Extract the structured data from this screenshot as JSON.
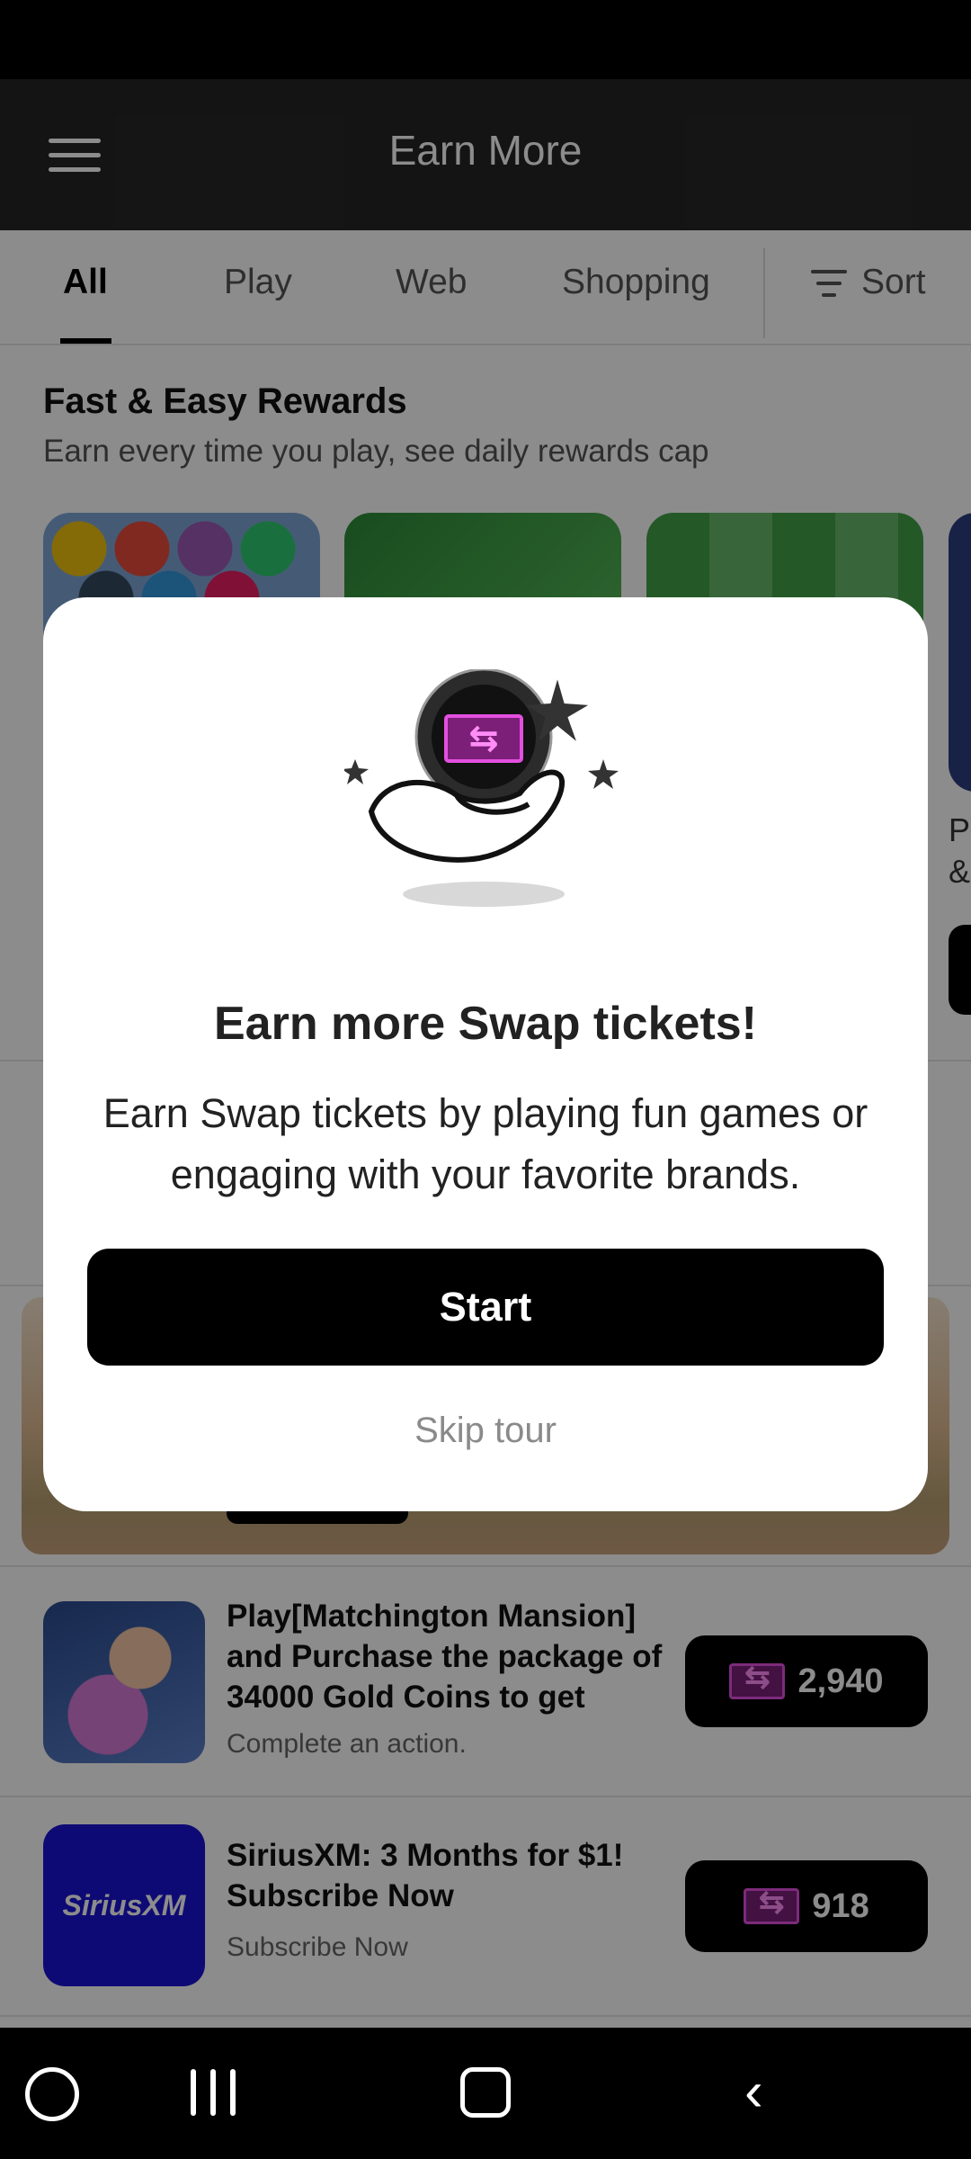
{
  "app_bar": {
    "title": "Earn More"
  },
  "tabs": [
    {
      "label": "All",
      "active": true
    },
    {
      "label": "Play"
    },
    {
      "label": "Web"
    },
    {
      "label": "Shopping"
    }
  ],
  "sort": {
    "label": "Sort",
    "icon": "filter-lines-icon"
  },
  "section": {
    "title": "Fast & Easy Rewards",
    "subtitle": "Earn every time you play, see daily rewards cap",
    "partial_card_text": "P\n&"
  },
  "offers": [
    {
      "title": "Play[Matchington Mansion] and Purchase the package of 34000 Gold Coins to get",
      "subtitle": "Complete an action.",
      "reward": "2,940"
    },
    {
      "title": "SiriusXM: 3 Months for $1! Subscribe Now",
      "subtitle": "Subscribe Now",
      "reward": "918",
      "logo_text": "SiriusXM"
    }
  ],
  "modal": {
    "title": "Earn more Swap tickets!",
    "body": "Earn Swap tickets by playing fun games or engaging with your favorite brands.",
    "primary_button": "Start",
    "secondary_link": "Skip tour"
  },
  "colors": {
    "app_bar": "#262626",
    "ticket_accent": "#e44fe0",
    "siriusxm_blue": "#1a13d6"
  }
}
